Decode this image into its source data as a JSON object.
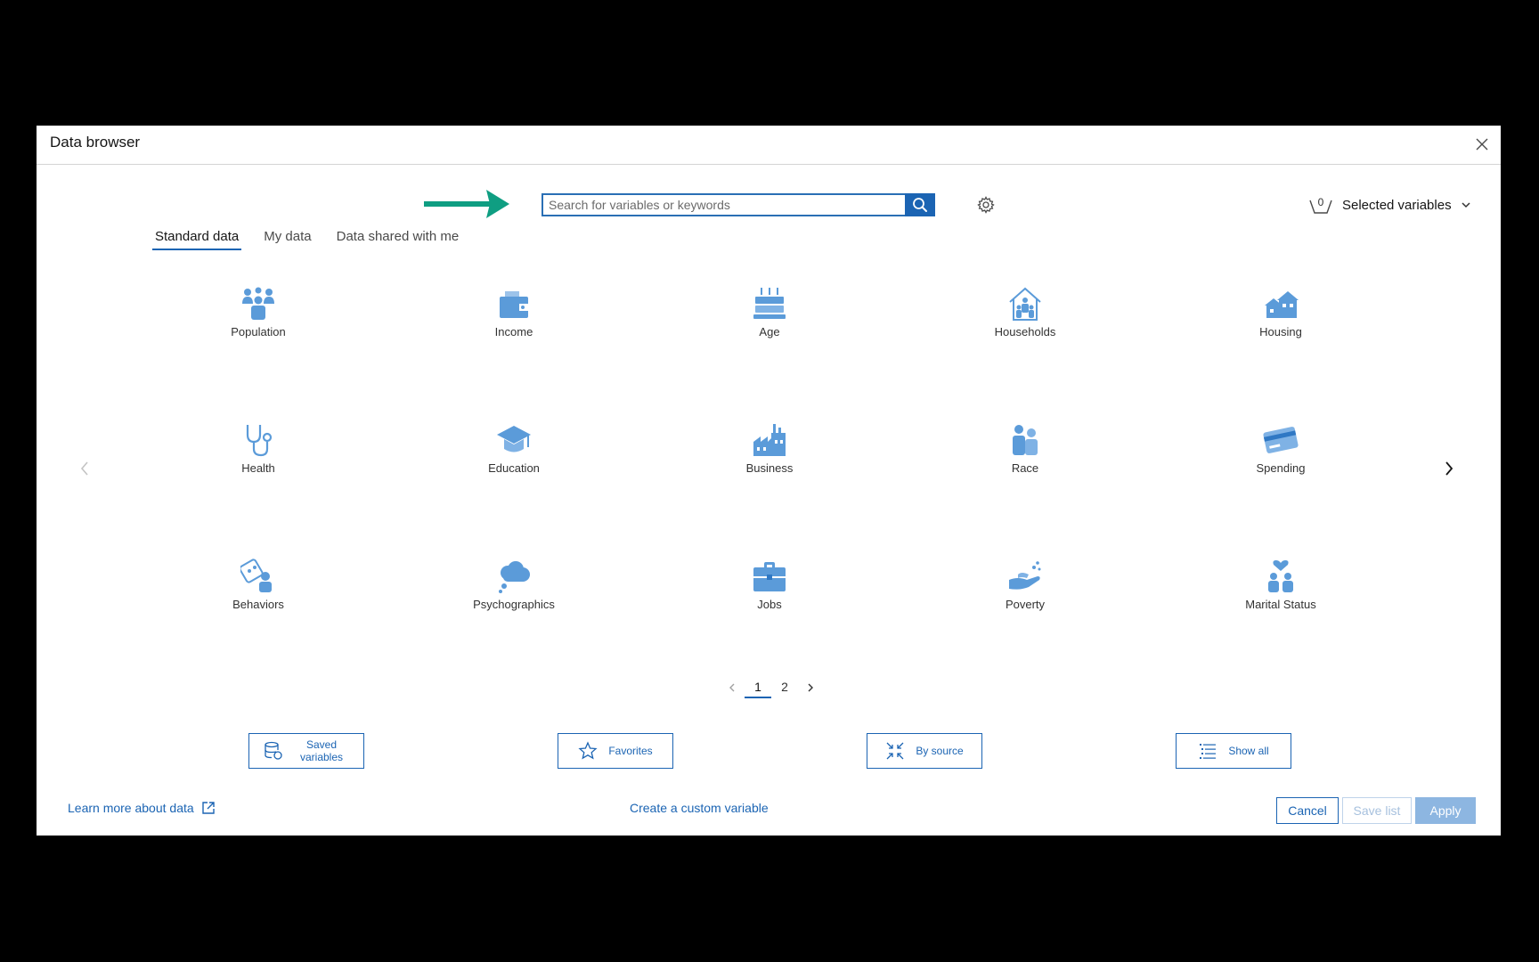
{
  "dialog": {
    "title": "Data browser"
  },
  "search": {
    "placeholder": "Search for variables or keywords"
  },
  "selected_variables": {
    "count": "0",
    "label": "Selected variables"
  },
  "tabs": [
    {
      "label": "Standard data",
      "active": true
    },
    {
      "label": "My data",
      "active": false
    },
    {
      "label": "Data shared with me",
      "active": false
    }
  ],
  "categories": [
    {
      "label": "Population",
      "icon": "population-icon"
    },
    {
      "label": "Income",
      "icon": "income-icon"
    },
    {
      "label": "Age",
      "icon": "age-icon"
    },
    {
      "label": "Households",
      "icon": "households-icon"
    },
    {
      "label": "Housing",
      "icon": "housing-icon"
    },
    {
      "label": "Health",
      "icon": "health-icon"
    },
    {
      "label": "Education",
      "icon": "education-icon"
    },
    {
      "label": "Business",
      "icon": "business-icon"
    },
    {
      "label": "Race",
      "icon": "race-icon"
    },
    {
      "label": "Spending",
      "icon": "spending-icon"
    },
    {
      "label": "Behaviors",
      "icon": "behaviors-icon"
    },
    {
      "label": "Psychographics",
      "icon": "psychographics-icon"
    },
    {
      "label": "Jobs",
      "icon": "jobs-icon"
    },
    {
      "label": "Poverty",
      "icon": "poverty-icon"
    },
    {
      "label": "Marital Status",
      "icon": "marital-status-icon"
    }
  ],
  "pagination": {
    "pages": [
      "1",
      "2"
    ],
    "current": "1"
  },
  "quick_buttons": [
    {
      "label": "Saved variables",
      "icon": "database-icon"
    },
    {
      "label": "Favorites",
      "icon": "star-icon"
    },
    {
      "label": "By source",
      "icon": "collapse-arrows-icon"
    },
    {
      "label": "Show all",
      "icon": "list-icon"
    }
  ],
  "footer": {
    "learn_more": "Learn more about data",
    "create_custom": "Create a custom variable",
    "cancel": "Cancel",
    "save_list": "Save list",
    "apply": "Apply"
  },
  "colors": {
    "accent": "#1b64b3",
    "icon_blue": "#5b9bd9",
    "arrow_green": "#0f9e82"
  }
}
